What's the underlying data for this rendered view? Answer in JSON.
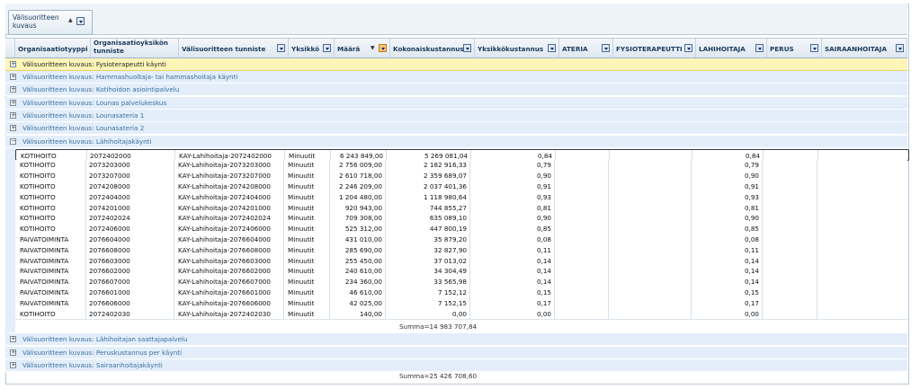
{
  "group_chip": {
    "label": "Välisuoritteen kuvaus"
  },
  "columns": [
    {
      "label": "Organisaatiotyyppi"
    },
    {
      "label": "Organisaatioyksikön tunniste"
    },
    {
      "label": "Välisuoritteen tunniste"
    },
    {
      "label": "Yksikkö"
    },
    {
      "label": "Määrä"
    },
    {
      "label": "Kokonaiskustannus"
    },
    {
      "label": "Yksikkökustannus"
    },
    {
      "label": "ATERIA"
    },
    {
      "label": "FYSIOTERAPEUTTI"
    },
    {
      "label": "LAHIHOITAJA"
    },
    {
      "label": "PERUS"
    },
    {
      "label": "SAIRAANHOITAJA"
    }
  ],
  "groups_top": [
    {
      "label": "Välisuoritteen kuvaus: Fysioterapeutti käynti"
    },
    {
      "label": "Välisuoritteen kuvaus: Hammashuoltaja- tai hammashoitaja käynti"
    },
    {
      "label": "Välisuoritteen kuvaus: Kotihoidon asiointipalvelu"
    },
    {
      "label": "Välisuoritteen kuvaus: Lounas palvelukeskus"
    },
    {
      "label": "Välisuoritteen kuvaus: Lounasateria 1"
    },
    {
      "label": "Välisuoritteen kuvaus: Lounasateria 2"
    },
    {
      "label": "Välisuoritteen kuvaus: Lähihoitajakäynti"
    }
  ],
  "rows": [
    {
      "org": "KOTIHOITO",
      "unit": "2072402000",
      "id": "KAY-Lahihoitaja-2072402000",
      "yks": "Minuutit",
      "maara": "6 243 849,00",
      "kok": "5 269 081,04",
      "ykk": "0,84",
      "lah": "0,84"
    },
    {
      "org": "KOTIHOITO",
      "unit": "2073203000",
      "id": "KAY-Lahihoitaja-2073203000",
      "yks": "Minuutit",
      "maara": "2 756 009,00",
      "kok": "2 182 916,33",
      "ykk": "0,79",
      "lah": "0,79"
    },
    {
      "org": "KOTIHOITO",
      "unit": "2073207000",
      "id": "KAY-Lahihoitaja-2073207000",
      "yks": "Minuutit",
      "maara": "2 610 718,00",
      "kok": "2 359 689,07",
      "ykk": "0,90",
      "lah": "0,90"
    },
    {
      "org": "KOTIHOITO",
      "unit": "2074208000",
      "id": "KAY-Lahihoitaja-2074208000",
      "yks": "Minuutit",
      "maara": "2 246 209,00",
      "kok": "2 037 401,36",
      "ykk": "0,91",
      "lah": "0,91"
    },
    {
      "org": "KOTIHOITO",
      "unit": "2072404000",
      "id": "KAY-Lahihoitaja-2072404000",
      "yks": "Minuutit",
      "maara": "1 204 480,00",
      "kok": "1 118 980,64",
      "ykk": "0,93",
      "lah": "0,93"
    },
    {
      "org": "KOTIHOITO",
      "unit": "2074201000",
      "id": "KAY-Lahihoitaja-2074201000",
      "yks": "Minuutit",
      "maara": "920 943,00",
      "kok": "744 855,27",
      "ykk": "0,81",
      "lah": "0,81"
    },
    {
      "org": "KOTIHOITO",
      "unit": "2072402024",
      "id": "KAY-Lahihoitaja-2072402024",
      "yks": "Minuutit",
      "maara": "709 308,00",
      "kok": "635 089,10",
      "ykk": "0,90",
      "lah": "0,90"
    },
    {
      "org": "KOTIHOITO",
      "unit": "2072406000",
      "id": "KAY-Lahihoitaja-2072406000",
      "yks": "Minuutit",
      "maara": "525 312,00",
      "kok": "447 800,19",
      "ykk": "0,85",
      "lah": "0,85"
    },
    {
      "org": "PAIVATOIMINTA",
      "unit": "2076604000",
      "id": "KAY-Lahihoitaja-2076604000",
      "yks": "Minuutit",
      "maara": "431 010,00",
      "kok": "35 879,20",
      "ykk": "0,08",
      "lah": "0,08"
    },
    {
      "org": "PAIVATOIMINTA",
      "unit": "2076608000",
      "id": "KAY-Lahihoitaja-2076608000",
      "yks": "Minuutit",
      "maara": "285 690,00",
      "kok": "32 827,90",
      "ykk": "0,11",
      "lah": "0,11"
    },
    {
      "org": "PAIVATOIMINTA",
      "unit": "2076603000",
      "id": "KAY-Lahihoitaja-2076603000",
      "yks": "Minuutit",
      "maara": "255 450,00",
      "kok": "37 013,02",
      "ykk": "0,14",
      "lah": "0,14"
    },
    {
      "org": "PAIVATOIMINTA",
      "unit": "2076602000",
      "id": "KAY-Lahihoitaja-2076602000",
      "yks": "Minuutit",
      "maara": "240 610,00",
      "kok": "34 304,49",
      "ykk": "0,14",
      "lah": "0,14"
    },
    {
      "org": "PAIVATOIMINTA",
      "unit": "2076607000",
      "id": "KAY-Lahihoitaja-2076607000",
      "yks": "Minuutit",
      "maara": "234 360,00",
      "kok": "33 565,98",
      "ykk": "0,14",
      "lah": "0,14"
    },
    {
      "org": "PAIVATOIMINTA",
      "unit": "2076601000",
      "id": "KAY-Lahihoitaja-2076601000",
      "yks": "Minuutit",
      "maara": "46 610,00",
      "kok": "7 152,12",
      "ykk": "0,15",
      "lah": "0,15"
    },
    {
      "org": "PAIVATOIMINTA",
      "unit": "2076606000",
      "id": "KAY-Lahihoitaja-2076606000",
      "yks": "Minuutit",
      "maara": "42 025,00",
      "kok": "7 152,15",
      "ykk": "0,17",
      "lah": "0,17"
    },
    {
      "org": "KOTIHOITO",
      "unit": "2072402030",
      "id": "KAY-Lahihoitaja-2072402030",
      "yks": "Minuutit",
      "maara": "140,00",
      "kok": "0,00",
      "ykk": "0,00",
      "lah": "0,00"
    }
  ],
  "group_sum": "Summa=14 983 707,84",
  "groups_bottom": [
    {
      "label": "Välisuoritteen kuvaus: Lähihoitajan saattajapalvelu"
    },
    {
      "label": "Välisuoritteen kuvaus: Peruskustannus per käynti"
    },
    {
      "label": "Välisuoritteen kuvaus: Sairaanhoitajakäynti"
    }
  ],
  "total_sum": "Summa=25 426 708,60",
  "colors": {
    "group_bg": "#e3eefa",
    "highlight_bg": "#fff5b8",
    "link_text": "#3a6fa0",
    "header_bg": "#dfe7f0"
  }
}
